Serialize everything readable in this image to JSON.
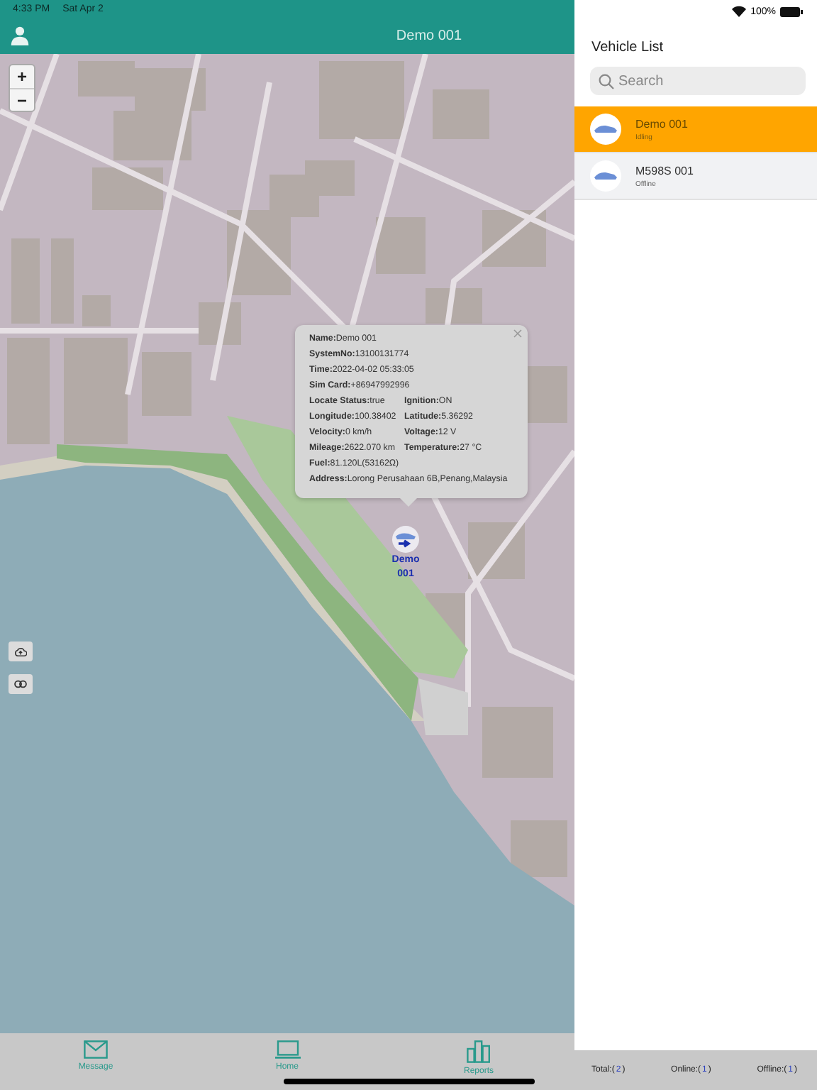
{
  "status_bar": {
    "time": "4:33 PM",
    "date": "Sat Apr 2",
    "battery": "100%"
  },
  "header": {
    "title": "Demo 001"
  },
  "map": {
    "popup": {
      "rows": [
        [
          {
            "label": "Name:",
            "value": "Demo 001"
          }
        ],
        [
          {
            "label": "SystemNo:",
            "value": "13100131774"
          }
        ],
        [
          {
            "label": "Time:",
            "value": "2022-04-02 05:33:05"
          }
        ],
        [
          {
            "label": "Sim Card:",
            "value": "+86947992996"
          }
        ],
        [
          {
            "label": "Locate Status:",
            "value": "true"
          },
          {
            "label": "Ignition:",
            "value": "ON"
          }
        ],
        [
          {
            "label": "Longitude:",
            "value": "100.38402"
          },
          {
            "label": "Latitude:",
            "value": "5.36292"
          }
        ],
        [
          {
            "label": "Velocity:",
            "value": "0 km/h"
          },
          {
            "label": "Voltage:",
            "value": "12 V"
          }
        ],
        [
          {
            "label": "Mileage:",
            "value": "2622.070 km"
          },
          {
            "label": "Temperature:",
            "value": "27 °C"
          }
        ],
        [
          {
            "label": "Fuel:",
            "value": "81.120L(53162Ω)"
          }
        ],
        [
          {
            "label": "Address:",
            "value": "Lorong Perusahaan 6B,Penang,Malaysia"
          }
        ]
      ]
    },
    "marker": {
      "label": "Demo 001"
    },
    "zoom_in": "+",
    "zoom_out": "−"
  },
  "tab_bar": [
    {
      "label": "Message",
      "kind": "mail"
    },
    {
      "label": "Home",
      "kind": "laptop"
    },
    {
      "label": "Reports",
      "kind": "chart"
    }
  ],
  "sidebar": {
    "title": "Vehicle List",
    "search": {
      "placeholder": "Search"
    },
    "vehicles": [
      {
        "name": "Demo 001",
        "status": "Idling",
        "selected": true
      },
      {
        "name": "M598S 001",
        "status": "Offline",
        "selected": false
      }
    ],
    "footer": [
      {
        "label": "Total:(",
        "count": "2",
        "close": ")"
      },
      {
        "label": "Online:(",
        "count": "1",
        "close": ")"
      },
      {
        "label": "Offline:(",
        "count": "1",
        "close": ")"
      }
    ]
  }
}
